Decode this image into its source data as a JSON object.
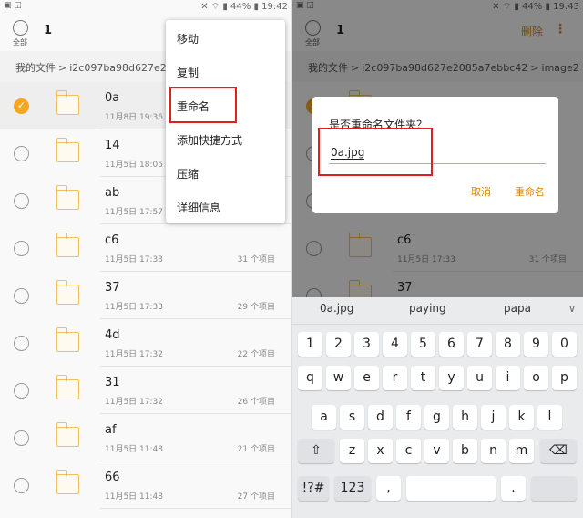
{
  "left": {
    "status": {
      "time": "19:42",
      "battery": "44%"
    },
    "select_all_label": "全部",
    "selected_count": "1",
    "breadcrumb": [
      "我的文件",
      "i2c097ba98d627e2085"
    ],
    "rows": [
      {
        "name": "0a",
        "date": "11月8日 19:36",
        "count": ""
      },
      {
        "name": "14",
        "date": "11月5日 18:05",
        "count": ""
      },
      {
        "name": "ab",
        "date": "11月5日 17:57",
        "count": ""
      },
      {
        "name": "c6",
        "date": "11月5日 17:33",
        "count": "31 个项目"
      },
      {
        "name": "37",
        "date": "11月5日 17:33",
        "count": "29 个项目"
      },
      {
        "name": "4d",
        "date": "11月5日 17:32",
        "count": "22 个项目"
      },
      {
        "name": "31",
        "date": "11月5日 17:32",
        "count": "26 个项目"
      },
      {
        "name": "af",
        "date": "11月5日 11:48",
        "count": "21 个项目"
      },
      {
        "name": "66",
        "date": "11月5日 11:48",
        "count": "27 个项目"
      }
    ],
    "menu": [
      "移动",
      "复制",
      "重命名",
      "添加快捷方式",
      "压缩",
      "详细信息"
    ]
  },
  "right": {
    "status": {
      "time": "19:43",
      "battery": "44%"
    },
    "select_all_label": "全部",
    "selected_count": "1",
    "delete_label": "删除",
    "breadcrumb": [
      "我的文件",
      "i2c097ba98d627e2085a7ebbc42",
      "image2"
    ],
    "rows": [
      {
        "name": "c6",
        "date": "11月5日 17:33",
        "count": "31 个项目"
      },
      {
        "name": "37",
        "date": "",
        "count": ""
      }
    ],
    "dialog": {
      "title": "是否重命名文件夹？",
      "input_value": "0a.jpg",
      "cancel": "取消",
      "ok": "重命名"
    },
    "keyboard": {
      "suggestions": [
        "0a.jpg",
        "paying",
        "papa"
      ],
      "row_numbers": [
        "1",
        "2",
        "3",
        "4",
        "5",
        "6",
        "7",
        "8",
        "9",
        "0"
      ],
      "row1": [
        "q",
        "w",
        "e",
        "r",
        "t",
        "y",
        "u",
        "i",
        "o",
        "p"
      ],
      "row2": [
        "a",
        "s",
        "d",
        "f",
        "g",
        "h",
        "j",
        "k",
        "l"
      ],
      "row3": [
        "z",
        "x",
        "c",
        "v",
        "b",
        "n",
        "m"
      ],
      "row4": [
        "!?#",
        "123",
        ",",
        "."
      ]
    }
  },
  "colors": {
    "accent": "#f5a623",
    "highlight_red": "#e02020"
  }
}
